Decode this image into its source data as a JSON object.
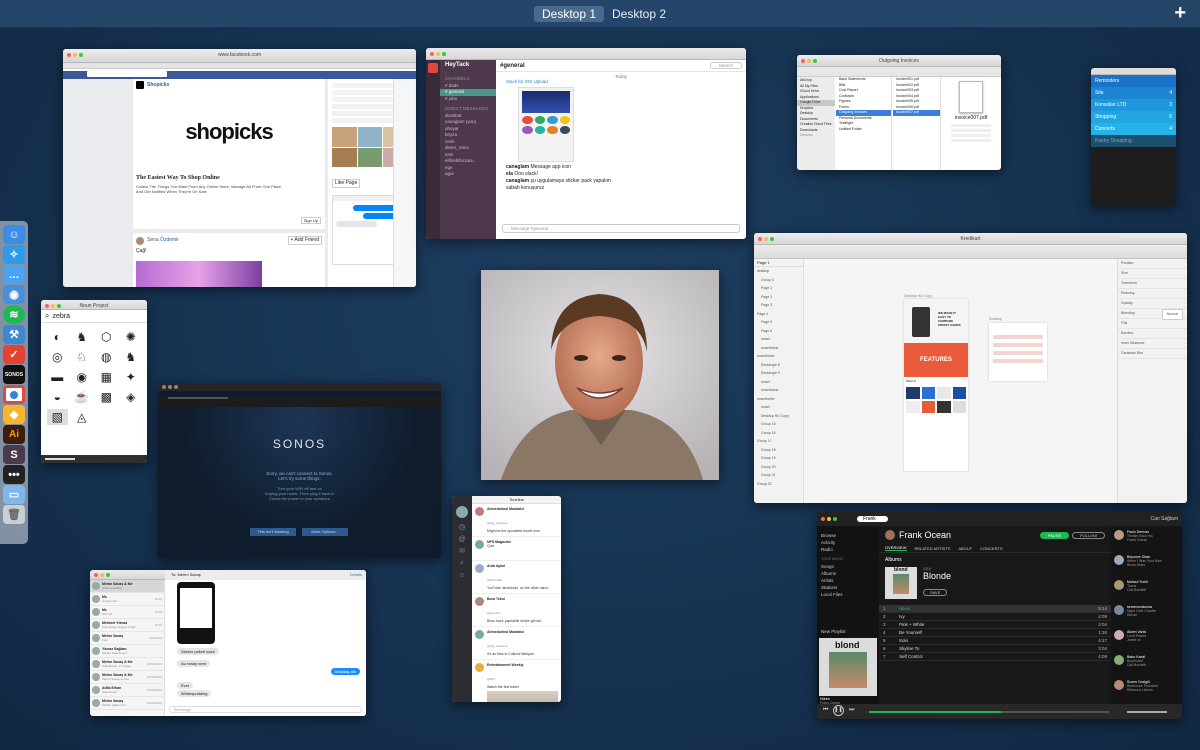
{
  "mission_control": {
    "spaces": [
      "Desktop 1",
      "Desktop 2"
    ],
    "active_space": "Desktop 1",
    "add_space_label": "+"
  },
  "dock": {
    "apps": [
      "finder-icon",
      "safari-icon",
      "messages-icon",
      "tweetbot-icon",
      "spotify-icon",
      "xcode-icon",
      "todoist-icon",
      "sonos-icon",
      "chrome-icon",
      "sketch-icon",
      "illustrator-icon",
      "slack-icon",
      "ellipsis-icon",
      "folder-icon",
      "trash-icon"
    ],
    "sonos_label": "SONOS",
    "ai_label": "Ai"
  },
  "facebook": {
    "address": "www.facebook.com",
    "page_name": "Shopicks",
    "logo_text": "shopicks",
    "tagline": "The Easiest Way To Shop Online",
    "desc": "Collect The Things You Want From Any Online Store, Manage All From One Place And Get Notified When They're On Sale",
    "signup": "Sign Up",
    "friend_name": "Sena Özdemir",
    "add_friend": "+ Add Friend",
    "post_text": "Çağ!",
    "like_page": "Like Page"
  },
  "slack": {
    "team": "HeyTack",
    "channel": "#general",
    "search_placeholder": "Search",
    "day": "Today",
    "section_channels": "CHANNELS",
    "channels": [
      "# dads",
      "# general",
      "# jobs"
    ],
    "section_dm": "DIRECT MESSAGES",
    "dms": [
      "slackbot",
      "canaglam (you)",
      "ahoyar",
      "beyza",
      "cenk",
      "dieter_rams",
      "emir",
      "elifnebibozacu",
      "ege",
      "ugur"
    ],
    "app_banner": "Slack for iOS Upload",
    "messages": [
      {
        "user": "canaglam",
        "text": "Message app icon"
      },
      {
        "user": "ela",
        "text": "Ooo slack!"
      },
      {
        "user": "canaglam",
        "text": "şu uygulamaya sticker pack yapalım"
      }
    ],
    "extra_line": "sabah konuşuruz",
    "input_placeholder": "Message #general"
  },
  "finder": {
    "title": "Outgoing Invoices",
    "favorites": [
      "AirDrop",
      "All My Files",
      "iCloud Drive",
      "Applications",
      "Google Drive",
      "Dropbox",
      "Desktop",
      "Documents",
      "Creative Cloud Files",
      "Downloads"
    ],
    "devices_label": "Devices",
    "column1": [
      "Bank Statements",
      "Bills",
      "Cost Report",
      "Contracts",
      "Figures",
      "Forms",
      "Outgoing Invoices",
      "Personal Documents",
      "Testflight",
      "Untitled Folder"
    ],
    "files": [
      "Invoice001.pdf",
      "Invoice002.pdf",
      "Invoice003.pdf",
      "Invoice004.pdf",
      "Invoice005.pdf",
      "Invoice006.pdf",
      "Invoice007.pdf"
    ],
    "selected_file": "invoice007.pdf",
    "preview_name": "invoice007.pdf"
  },
  "clear": {
    "lists": [
      {
        "name": "Reminders",
        "count": ""
      },
      {
        "name": "Site",
        "count": "4"
      },
      {
        "name": "Konsolier LTD",
        "count": "3"
      },
      {
        "name": "Shopping",
        "count": "6"
      },
      {
        "name": "Concerts",
        "count": "4"
      },
      {
        "name": "Pastry Shopping",
        "count": ""
      }
    ]
  },
  "sketch": {
    "title": "Kredikart",
    "pages": "Page 1",
    "layers": [
      "desktop",
      "Group 4",
      "Page 1",
      "Page 2",
      "Page 3",
      "Page 4",
      "Page 5",
      "Page 6",
      "smart",
      "smarthome",
      "smarthome",
      "Rectangle 8",
      "Rectangle 9",
      "smart",
      "smarthome",
      "smarthome",
      "smart",
      "Desktop HD Copy",
      "Group 15",
      "Group 16",
      "Group 17",
      "Group 18",
      "Group 19",
      "Group 20",
      "Group 21",
      "Group 22"
    ],
    "artboard_label": "Desktop HD Copy",
    "artboard2_label": "Desktop",
    "hero_text": "WE MADE IT EASY TO COMPARE CREDIT CARDS",
    "features_text": "FEATURES",
    "deals_text": "DEALS",
    "inspector": [
      "Position",
      "Size",
      "Transform",
      "Resizing",
      "Opacity",
      "Blending",
      "Fills",
      "Borders",
      "Inner Shadows",
      "Gaussian Blur"
    ],
    "blending_value": "Normal"
  },
  "icon_finder": {
    "title": "Noun Project",
    "search_value": "zebra"
  },
  "sonos": {
    "logo": "SONOS",
    "message_1": "Sorry, we can't connect to Sonos.",
    "message_2": "Let's try some things:",
    "tips": [
      "Turn your WiFi off and on",
      "Unplug your router. Then plug it back in",
      "Check the power to your speakers"
    ],
    "btn_left": "This isn't Working",
    "btn_right": "More Options..."
  },
  "messages_app": {
    "to_label": "To:",
    "recipient": "Mehm Savaş",
    "details": "Details",
    "conversations": [
      {
        "name": "Mehm Savaş & Me",
        "time": "",
        "preview": "Whitespudding"
      },
      {
        "name": "Ms",
        "time": "11:56",
        "preview": "ok bunu da"
      },
      {
        "name": "Me",
        "time": "15:08",
        "preview": "Ok it ok"
      },
      {
        "name": "Mehmet Yılmaz",
        "time": "12:16",
        "preview": "Telif yasayı okunuz bi gör"
      },
      {
        "name": "Mehm Savaş",
        "time": "Yesterday",
        "preview": "Foto"
      },
      {
        "name": "Yılmaz Sağlam",
        "time": "",
        "preview": "Sticker Attachment"
      },
      {
        "name": "Mehm Savaş & Me",
        "time": "23/09/2016",
        "preview": "Attachment: 2 images"
      },
      {
        "name": "Mehm Savaş & Me",
        "time": "21/09/2016",
        "preview": "Mehm Savaş ve ben"
      },
      {
        "name": "Atilla Erkan",
        "time": "12/09/2016",
        "preview": "Attachment"
      },
      {
        "name": "Mehm Savaş",
        "time": "16/09/2016",
        "preview": "Sticker gidiyor mu"
      }
    ],
    "bubbles": [
      "Sticker paketi nasıl",
      "Au ready nem",
      "Arkadaş attı",
      "Evet",
      "Whitespudding"
    ],
    "input_placeholder": "iMessage"
  },
  "tweetbot": {
    "title": "Timeline",
    "tweets": [
      {
        "user": "Ahmedulmol Mandalci",
        "handle": "@big_business",
        "text": "Might be the spookiest movie ever"
      },
      {
        "user": "NPS Magazine",
        "handle": "",
        "text": "Quiz"
      },
      {
        "user": "Arda Aykol",
        "handle": "@firefoxlab",
        "text": "YouTube Jarvislonic, on the other hand..."
      },
      {
        "user": "Bora Tekol",
        "handle": "@spectric",
        "text": "Biraz hazır yapılabilir ileriye görücü"
      },
      {
        "user": "Ahmedulmol Mandalci",
        "handle": "@big_business",
        "text": "It's as Mac in Cultural Weapon"
      },
      {
        "user": "Entertainment Weekly",
        "handle": "@EW",
        "text": "Watch the first trailer"
      }
    ]
  },
  "spotify": {
    "search_value": "Frank",
    "user": "Can Sağlam",
    "artist": "Frank Ocean",
    "play_label": "PAUSE",
    "follow_label": "FOLLOW",
    "tabs": [
      "OVERVIEW",
      "RELATED ARTISTS",
      "ABOUT",
      "CONCERTS"
    ],
    "albums_heading": "Albums",
    "album_label": "blond",
    "album_title": "Blonde",
    "album_year": "2016",
    "save_label": "SAVE",
    "nav_main": [
      "Browse",
      "Activity",
      "Radio"
    ],
    "nav_library_heading": "YOUR MUSIC",
    "nav_library": [
      "Songs",
      "Albums",
      "Artists",
      "Stations",
      "Local Files"
    ],
    "new_playlist": "New Playlist",
    "now_playing_title": "Nikes",
    "now_playing_artist": "Frank Ocean",
    "track_header": [
      "SONG",
      "",
      ""
    ],
    "tracks": [
      {
        "n": "1",
        "title": "Nikes",
        "time": "5:14"
      },
      {
        "n": "2",
        "title": "Ivy",
        "time": "4:09"
      },
      {
        "n": "3",
        "title": "Pink + White",
        "time": "3:04"
      },
      {
        "n": "4",
        "title": "Be Yourself",
        "time": "1:26"
      },
      {
        "n": "5",
        "title": "Solo",
        "time": "4:17"
      },
      {
        "n": "6",
        "title": "Skyline To",
        "time": "3:04"
      },
      {
        "n": "7",
        "title": "Self Control",
        "time": "4:09"
      }
    ],
    "friends": [
      {
        "name": "Pasin Derman",
        "track": "Thinkin Bout You",
        "artist": "Frank Ocean"
      },
      {
        "name": "Beyonce Okan",
        "track": "When I Was Your Man",
        "artist": "Bruno Mars"
      },
      {
        "name": "Mahsut Turkil",
        "track": "Tacos",
        "artist": "Cali Bordetti"
      },
      {
        "name": "secemonatunna",
        "track": "Night Club Crawler",
        "artist": "Serum"
      },
      {
        "name": "Alicen Varlık",
        "track": "Loud Places",
        "artist": "Jamie xx"
      },
      {
        "name": "Batur Kamil",
        "track": "Boulevard",
        "artist": "Cali Bordetti"
      },
      {
        "name": "Susen Ooslgül",
        "track": "Birdhouse Polarized",
        "artist": "Rebecca Lebron"
      }
    ]
  },
  "photo": {
    "alt": "photo-of-smiling-man"
  },
  "colors": {
    "desktop_bg": "#163250",
    "slack_sidebar": "#4d394b",
    "spotify_green": "#1db954",
    "clear_blue": "#1aa6e0",
    "sonos_bg": "#0f1c2c"
  }
}
